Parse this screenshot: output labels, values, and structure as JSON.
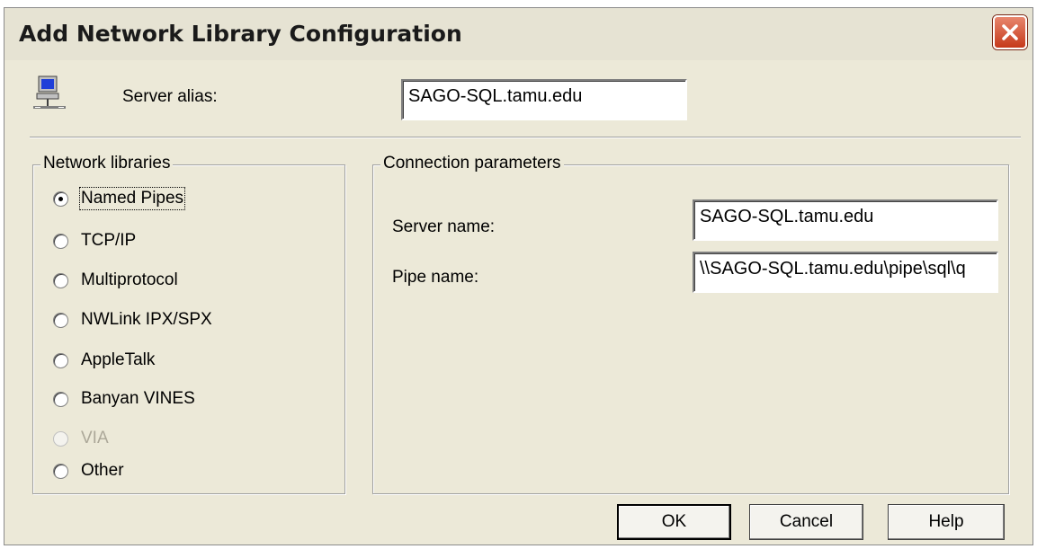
{
  "window": {
    "title": "Add Network Library Configuration"
  },
  "alias": {
    "label": "Server alias:",
    "value": "SAGO-SQL.tamu.edu"
  },
  "network_libraries": {
    "title": "Network libraries",
    "options": [
      {
        "label": "Named Pipes",
        "checked": true,
        "disabled": false
      },
      {
        "label": "TCP/IP",
        "checked": false,
        "disabled": false
      },
      {
        "label": "Multiprotocol",
        "checked": false,
        "disabled": false
      },
      {
        "label": "NWLink IPX/SPX",
        "checked": false,
        "disabled": false
      },
      {
        "label": "AppleTalk",
        "checked": false,
        "disabled": false
      },
      {
        "label": "Banyan VINES",
        "checked": false,
        "disabled": false
      },
      {
        "label": "VIA",
        "checked": false,
        "disabled": true
      },
      {
        "label": "Other",
        "checked": false,
        "disabled": false
      }
    ]
  },
  "connection": {
    "title": "Connection parameters",
    "server_name_label": "Server name:",
    "server_name_value": "SAGO-SQL.tamu.edu",
    "pipe_name_label": "Pipe name:",
    "pipe_name_value": "\\\\SAGO-SQL.tamu.edu\\pipe\\sql\\q"
  },
  "buttons": {
    "ok": "OK",
    "cancel": "Cancel",
    "help": "Help"
  },
  "icons": {
    "computer": "network-computer-icon",
    "close": "close-icon"
  },
  "colors": {
    "dialog_bg": "#ece9d8",
    "close_red": "#c6391b"
  }
}
